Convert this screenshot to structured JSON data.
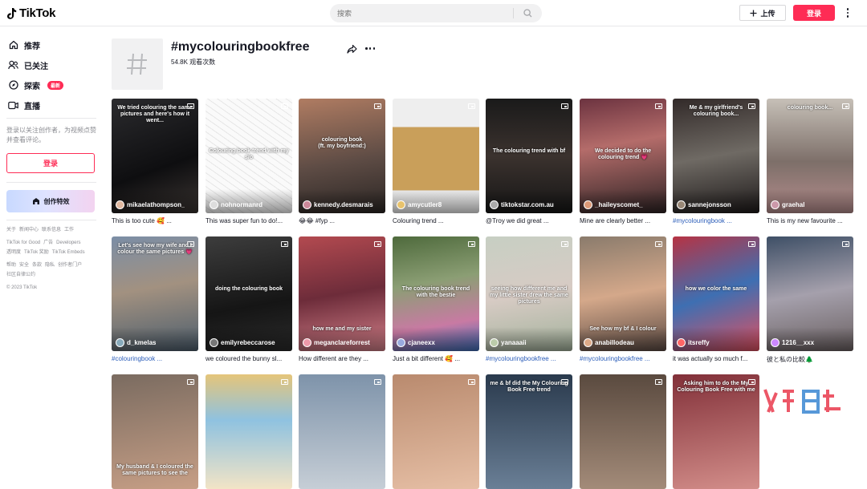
{
  "header": {
    "logo_text": "TikTok",
    "search_placeholder": "搜索",
    "upload_label": "上传",
    "login_label": "登录"
  },
  "sidebar": {
    "nav": [
      {
        "label": "推荐",
        "icon": "home-icon"
      },
      {
        "label": "已关注",
        "icon": "following-icon"
      },
      {
        "label": "探索",
        "icon": "compass-icon",
        "badge": "最新"
      },
      {
        "label": "直播",
        "icon": "live-icon"
      }
    ],
    "prompt": "登录以关注创作者，为视频点赞并查看评论。",
    "login_label": "登录",
    "effects_label": "创作特效",
    "footer_rows": [
      [
        "关于",
        "新闻中心",
        "联系信息",
        "工作"
      ],
      [
        "TikTok for Good",
        "广告",
        "Developers"
      ],
      [
        "透明度",
        "TikTok 奖励",
        "TikTok Embeds"
      ],
      [
        "帮助",
        "安全",
        "条款",
        "隐私",
        "创作者门户"
      ],
      [
        "社区自律公约"
      ]
    ],
    "copyright": "© 2023 TikTok"
  },
  "tag": {
    "title": "#mycolouringbookfree",
    "views": "54.8K 观看次数"
  },
  "colors": {
    "accent": "#fe2c55",
    "hashtag": "#2b5db9"
  },
  "videos": [
    {
      "author": "mikaelathompson_",
      "caption": "This is too cute 🥰 ...",
      "overlay": "We tried colouring the same pictures and here's how it went...",
      "overlay_pos": "top",
      "caption_is_tag": false
    },
    {
      "author": "nohnormanrd",
      "caption": "This was super fun to do!...",
      "overlay": "Colouring book trend with my s/o",
      "overlay_pos": "mid",
      "caption_is_tag": false
    },
    {
      "author": "kennedy.desmarais",
      "caption": "😂😂 #fyp ...",
      "overlay": "colouring book\n(ft. my boyfriend:)",
      "overlay_pos": "upper",
      "caption_is_tag": false
    },
    {
      "author": "amycutler8",
      "caption": "Colouring trend ...",
      "overlay": "",
      "overlay_pos": "none",
      "caption_is_tag": false
    },
    {
      "author": "tiktokstar.com.au",
      "caption": "@Troy we did great ...",
      "overlay": "The colouring trend with bf",
      "overlay_pos": "mid",
      "caption_is_tag": false
    },
    {
      "author": "_haileyscomet_",
      "caption": "Mine are clearly better ...",
      "overlay": "We decided to do the colouring trend 💗",
      "overlay_pos": "mid",
      "caption_is_tag": false
    },
    {
      "author": "sannejonsson",
      "caption": "#mycolouringbook ...",
      "overlay": "Me & my girlfriend's colouring book...",
      "overlay_pos": "top",
      "caption_is_tag": true
    },
    {
      "author": "graehal",
      "caption": "This is my new favourite ...",
      "overlay": "colouring book...",
      "overlay_pos": "top",
      "caption_is_tag": false
    },
    {
      "author": "d_kmelas",
      "caption": "#colouringbook ...",
      "overlay": "Let's see how my wife and I colour the same pictures 💗",
      "overlay_pos": "top",
      "caption_is_tag": true
    },
    {
      "author": "emilyrebeccarose",
      "caption": "we coloured the bunny sl...",
      "overlay": "doing the colouring book",
      "overlay_pos": "mid",
      "caption_is_tag": false
    },
    {
      "author": "meganclareforrest",
      "caption": "How different are they ...",
      "overlay": "how me and my sister",
      "overlay_pos": "low",
      "caption_is_tag": false
    },
    {
      "author": "cjaneexx",
      "caption": "Just a bit different 🥰 ...",
      "overlay": "The colouring book trend with the bestie",
      "overlay_pos": "mid",
      "caption_is_tag": false
    },
    {
      "author": "yanaaaii",
      "caption": "#mycolouringbookfree ...",
      "overlay": "seeing how different me and my little sister drew the same pictures",
      "overlay_pos": "mid",
      "caption_is_tag": true
    },
    {
      "author": "anabillodeau",
      "caption": "#mycolouringbookfree ...",
      "overlay": "See how my bf & I colour",
      "overlay_pos": "low",
      "caption_is_tag": true
    },
    {
      "author": "itsreffy",
      "caption": "it was actually so much f...",
      "overlay": "how we color the same",
      "overlay_pos": "mid",
      "caption_is_tag": false
    },
    {
      "author": "1216__xxx",
      "caption": "彼と私の比較🌲",
      "overlay": "",
      "overlay_pos": "none",
      "caption_is_tag": false
    },
    {
      "author": "",
      "caption": "",
      "overlay": "My husband & I coloured the same pictures to see the",
      "overlay_pos": "low",
      "caption_is_tag": false
    },
    {
      "author": "",
      "caption": "",
      "overlay": "",
      "overlay_pos": "none",
      "caption_is_tag": false
    },
    {
      "author": "",
      "caption": "",
      "overlay": "",
      "overlay_pos": "none",
      "caption_is_tag": false
    },
    {
      "author": "",
      "caption": "",
      "overlay": "",
      "overlay_pos": "none",
      "caption_is_tag": false
    },
    {
      "author": "",
      "caption": "",
      "overlay": "me & bf did the My Colouring Book Free trend",
      "overlay_pos": "top",
      "caption_is_tag": false
    },
    {
      "author": "",
      "caption": "",
      "overlay": "",
      "overlay_pos": "none",
      "caption_is_tag": false
    },
    {
      "author": "",
      "caption": "",
      "overlay": "Asking him to do the My Colouring Book Free with me",
      "overlay_pos": "top",
      "caption_is_tag": false
    }
  ]
}
